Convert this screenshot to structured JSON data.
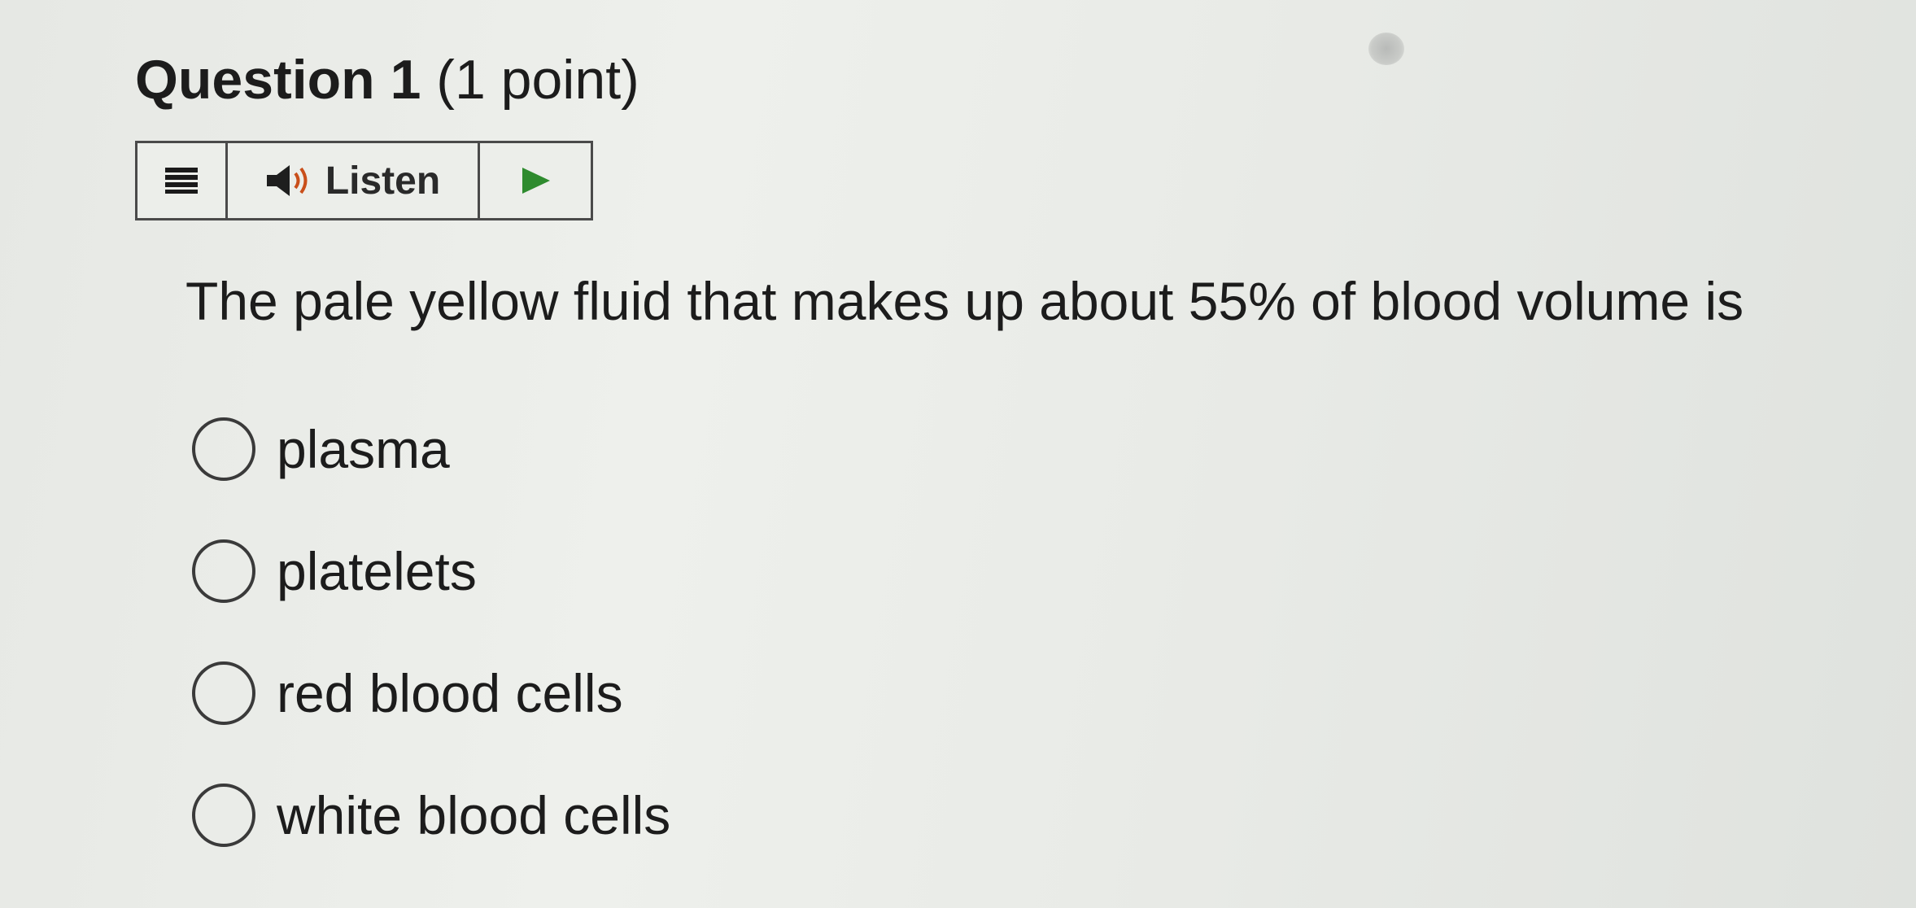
{
  "question": {
    "label": "Question 1",
    "points": "(1 point)",
    "text": "The pale yellow fluid that makes up about 55% of blood volume is"
  },
  "toolbar": {
    "menu_icon": "menu-icon",
    "listen_label": "Listen",
    "speaker_icon": "speaker-icon",
    "play_icon": "play-icon",
    "play_color": "#2e8b2e"
  },
  "options": [
    {
      "label": "plasma"
    },
    {
      "label": "platelets"
    },
    {
      "label": "red blood cells"
    },
    {
      "label": "white blood cells"
    }
  ]
}
